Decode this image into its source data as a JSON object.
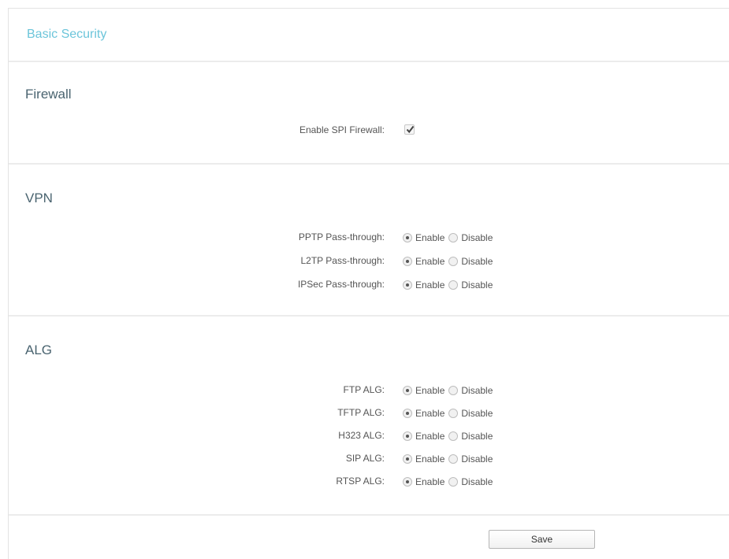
{
  "page_title": "Basic Security",
  "firewall": {
    "title": "Firewall",
    "spi_label": "Enable SPI Firewall:",
    "spi_checked": true
  },
  "vpn": {
    "title": "VPN",
    "rows": [
      {
        "label": "PPTP Pass-through:",
        "enable": "Enable",
        "disable": "Disable",
        "selected": "Enable"
      },
      {
        "label": "L2TP Pass-through:",
        "enable": "Enable",
        "disable": "Disable",
        "selected": "Enable"
      },
      {
        "label": "IPSec Pass-through:",
        "enable": "Enable",
        "disable": "Disable",
        "selected": "Enable"
      }
    ]
  },
  "alg": {
    "title": "ALG",
    "rows": [
      {
        "label": "FTP ALG:",
        "enable": "Enable",
        "disable": "Disable",
        "selected": "Enable"
      },
      {
        "label": "TFTP ALG:",
        "enable": "Enable",
        "disable": "Disable",
        "selected": "Enable"
      },
      {
        "label": "H323 ALG:",
        "enable": "Enable",
        "disable": "Disable",
        "selected": "Enable"
      },
      {
        "label": "SIP ALG:",
        "enable": "Enable",
        "disable": "Disable",
        "selected": "Enable"
      },
      {
        "label": "RTSP ALG:",
        "enable": "Enable",
        "disable": "Disable",
        "selected": "Enable"
      }
    ]
  },
  "save_label": "Save",
  "colors": {
    "title_accent": "#6cc5da",
    "section_title": "#4a6470",
    "divider": "#ececec"
  }
}
